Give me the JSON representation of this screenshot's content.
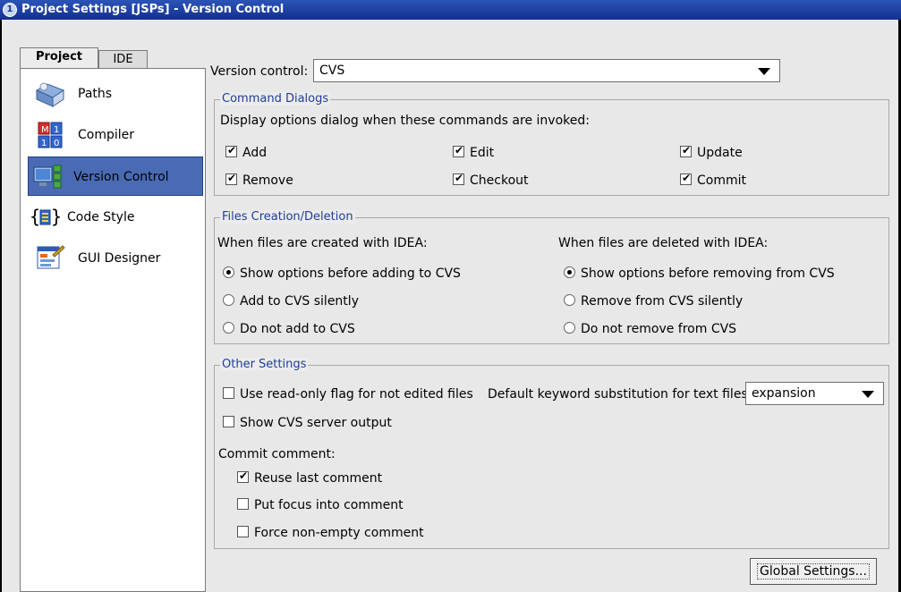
{
  "window": {
    "title": "Project Settings [JSPs] - Version Control",
    "title_icon": "1"
  },
  "tabs": [
    {
      "label": "Project",
      "active": true
    },
    {
      "label": "IDE",
      "active": false
    }
  ],
  "nav": [
    {
      "label": "Paths",
      "icon": "paths-icon"
    },
    {
      "label": "Compiler",
      "icon": "compiler-icon"
    },
    {
      "label": "Version Control",
      "icon": "version-control-icon",
      "selected": true
    },
    {
      "label": "Code Style",
      "icon": "code-style-icon"
    },
    {
      "label": "GUI Designer",
      "icon": "gui-designer-icon"
    }
  ],
  "version_control": {
    "label": "Version control:",
    "value": "CVS"
  },
  "command_dialogs": {
    "title": "Command Dialogs",
    "description": "Display options dialog when these commands are invoked:",
    "options": [
      {
        "label": "Add",
        "checked": true
      },
      {
        "label": "Edit",
        "checked": true
      },
      {
        "label": "Update",
        "checked": true
      },
      {
        "label": "Remove",
        "checked": true
      },
      {
        "label": "Checkout",
        "checked": true
      },
      {
        "label": "Commit",
        "checked": true
      }
    ]
  },
  "files_creation": {
    "title": "Files Creation/Deletion",
    "created_label": "When files are created with IDEA:",
    "deleted_label": "When files are deleted with IDEA:",
    "created_options": [
      {
        "label": "Show options before adding to CVS",
        "selected": true
      },
      {
        "label": "Add to CVS silently",
        "selected": false
      },
      {
        "label": "Do not add  to CVS",
        "selected": false
      }
    ],
    "deleted_options": [
      {
        "label": "Show options before removing from CVS",
        "selected": true
      },
      {
        "label": "Remove from CVS silently",
        "selected": false
      },
      {
        "label": "Do not remove from CVS",
        "selected": false
      }
    ]
  },
  "other_settings": {
    "title": "Other Settings",
    "readonly_flag": {
      "label": "Use read-only flag for not edited files",
      "checked": false
    },
    "keyword_label": "Default keyword substitution for text files",
    "keyword_value": "expansion",
    "show_server_output": {
      "label": "Show CVS server output",
      "checked": false
    },
    "commit_comment_label": "Commit comment:",
    "commit_options": [
      {
        "label": "Reuse last comment",
        "checked": true
      },
      {
        "label": "Put focus into comment",
        "checked": false
      },
      {
        "label": "Force non-empty comment",
        "checked": false
      }
    ]
  },
  "buttons": {
    "global_settings": "Global Settings..."
  },
  "colors": {
    "titlebar": "#12308e",
    "selection": "#4a6bb4",
    "group_title": "#1d3d9a"
  }
}
